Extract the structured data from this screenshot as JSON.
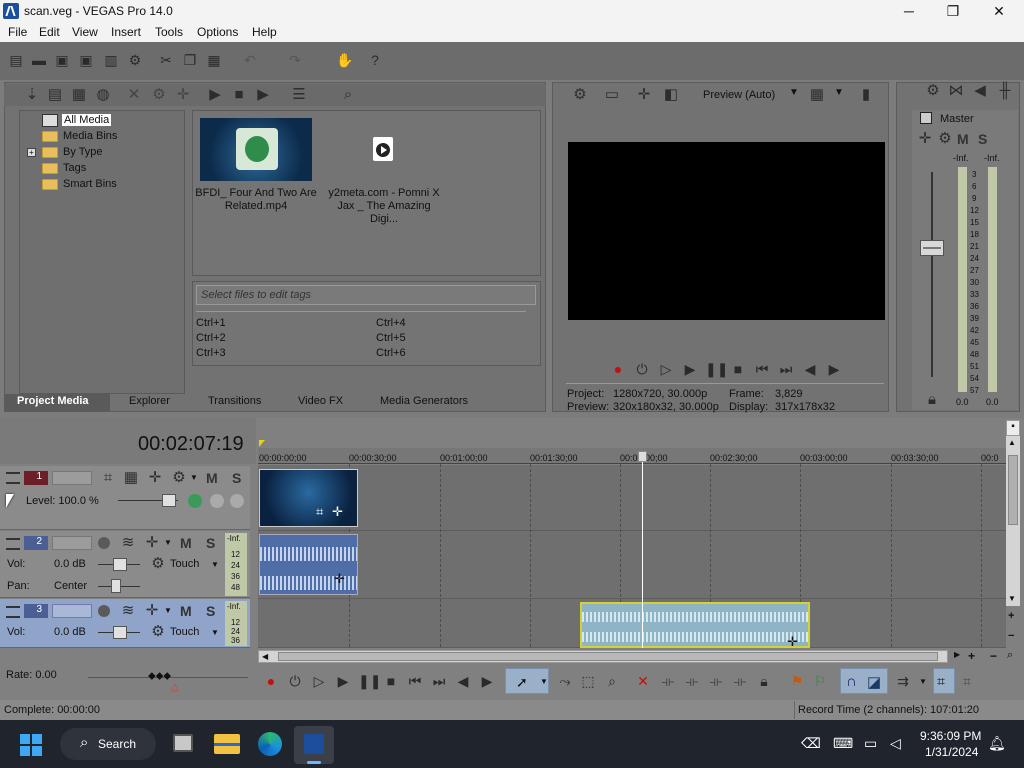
{
  "window": {
    "title": "scan.veg - VEGAS Pro 14.0",
    "minimize": "─",
    "maximize": "❐",
    "close": "✕"
  },
  "menu": [
    "File",
    "Edit",
    "View",
    "Insert",
    "Tools",
    "Options",
    "Help"
  ],
  "project_media": {
    "tree": [
      "All Media",
      "Media Bins",
      "By Type",
      "Tags",
      "Smart Bins"
    ],
    "expand_symbol": "+",
    "files": [
      {
        "name": "BFDI_ Four And Two Are Related.mp4"
      },
      {
        "name": "y2meta.com - Pomni X Jax _ The Amazing Digi..."
      }
    ],
    "tags_placeholder": "Select files to edit tags",
    "shortcuts": [
      "Ctrl+1",
      "Ctrl+2",
      "Ctrl+3",
      "Ctrl+4",
      "Ctrl+5",
      "Ctrl+6"
    ]
  },
  "tabs": [
    "Project Media",
    "Explorer",
    "Transitions",
    "Video FX",
    "Media Generators"
  ],
  "preview": {
    "quality": "Preview (Auto)",
    "project_label": "Project:",
    "project_value": "1280x720, 30.000p",
    "preview_label": "Preview:",
    "preview_value": "320x180x32, 30.000p",
    "frame_label": "Frame:",
    "frame_value": "3,829",
    "display_label": "Display:",
    "display_value": "317x178x32"
  },
  "master": {
    "title": "Master",
    "m": "M",
    "s": "S",
    "peak_left": "-Inf.",
    "peak_right": "-Inf.",
    "scale": [
      "3",
      "6",
      "9",
      "12",
      "15",
      "18",
      "21",
      "24",
      "27",
      "30",
      "33",
      "36",
      "39",
      "42",
      "45",
      "48",
      "51",
      "54",
      "57"
    ],
    "bottom_left": "0.0",
    "bottom_right": "0.0"
  },
  "timeline": {
    "timecode": "00:02:07:19",
    "ruler": [
      "00:00:00;00",
      "00:00:30;00",
      "00:01:00;00",
      "00:01:30;00",
      "00:02:00;00",
      "00:02:30;00",
      "00:03:00;00",
      "00:03:30;00",
      "00:0"
    ],
    "tracks": [
      {
        "number": "1",
        "type": "video",
        "level_label": "Level: 100.0 %",
        "m": "M",
        "s": "S"
      },
      {
        "number": "2",
        "type": "audio",
        "vol_label": "Vol:",
        "vol_value": "0.0 dB",
        "pan_label": "Pan:",
        "pan_value": "Center",
        "mode": "Touch",
        "m": "M",
        "s": "S",
        "meter": [
          "-Inf.",
          "12",
          "24",
          "36",
          "48"
        ]
      },
      {
        "number": "3",
        "type": "audio",
        "vol_label": "Vol:",
        "vol_value": "0.0 dB",
        "mode": "Touch",
        "m": "M",
        "s": "S",
        "meter": [
          "-Inf.",
          "12",
          "24",
          "36"
        ]
      }
    ],
    "rate": "Rate: 0.00"
  },
  "status": {
    "left": "Complete: 00:00:00",
    "right": "Record Time (2 channels): 107:01:20"
  },
  "taskbar": {
    "search": "Search",
    "time": "9:36:09 PM",
    "date": "1/31/2024"
  }
}
